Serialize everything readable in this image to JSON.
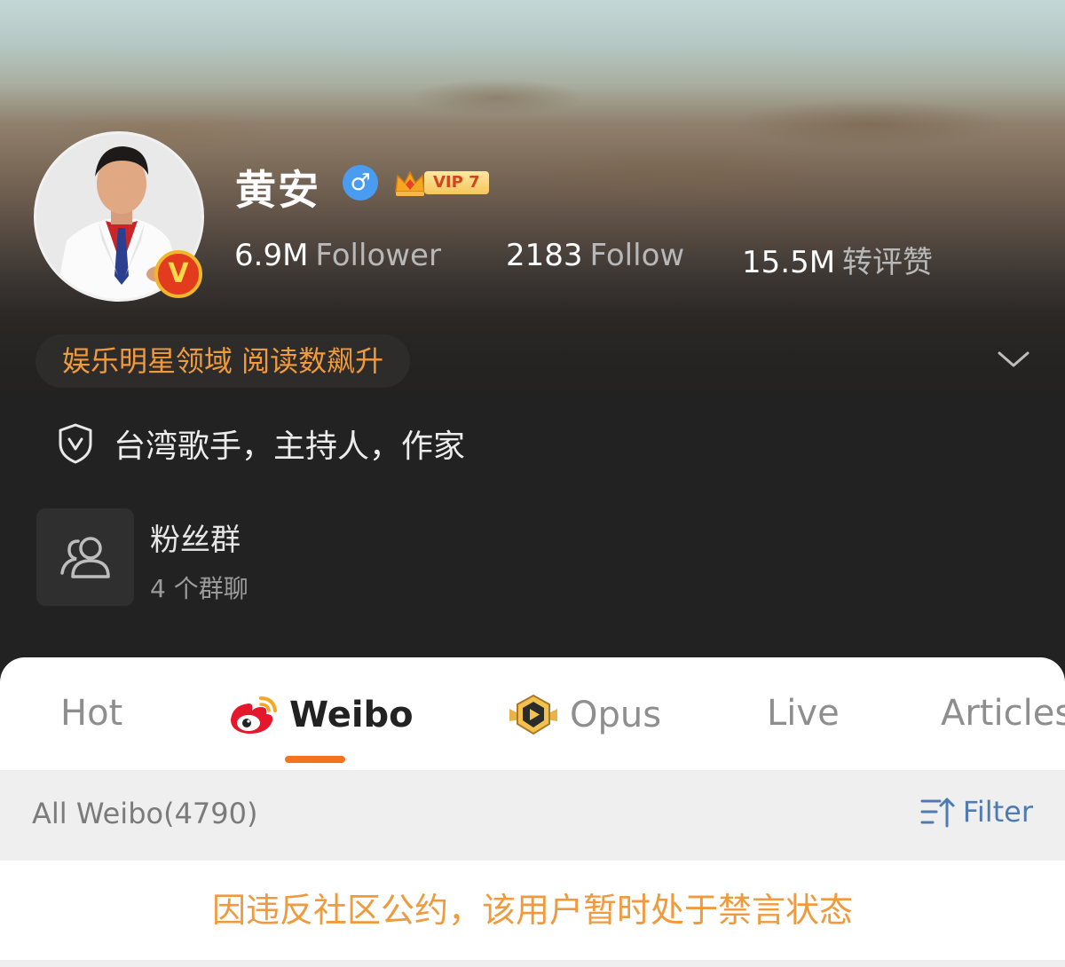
{
  "profile": {
    "name": "黄安",
    "gender_symbol": "♂",
    "vip_label": "VIP 7",
    "verified_badge": "V",
    "stats": [
      {
        "value": "6.9M",
        "label": "Follower"
      },
      {
        "value": "2183",
        "label": "Follow"
      },
      {
        "value": "15.5M",
        "label": "转评赞"
      }
    ],
    "tag": "娱乐明星领域 阅读数飙升",
    "bio": "台湾歌手，主持人，作家",
    "fan_group": {
      "title": "粉丝群",
      "subtitle": "4 个群聊"
    }
  },
  "tabs": [
    {
      "label": "Hot",
      "active": false
    },
    {
      "label": "Weibo",
      "active": true,
      "icon": "weibo-logo-icon"
    },
    {
      "label": "Opus",
      "active": false,
      "icon": "opus-play-icon"
    },
    {
      "label": "Live",
      "active": false
    },
    {
      "label": "Articles",
      "active": false
    }
  ],
  "feed": {
    "count_label": "All Weibo(4790)",
    "filter_label": "Filter",
    "notice": "因违反社区公约，该用户暂时处于禁言状态"
  },
  "colors": {
    "accent_orange": "#f3731f",
    "tag_orange": "#f09a3e",
    "filter_blue": "#4f7bb3",
    "dark_bg": "#222222"
  }
}
